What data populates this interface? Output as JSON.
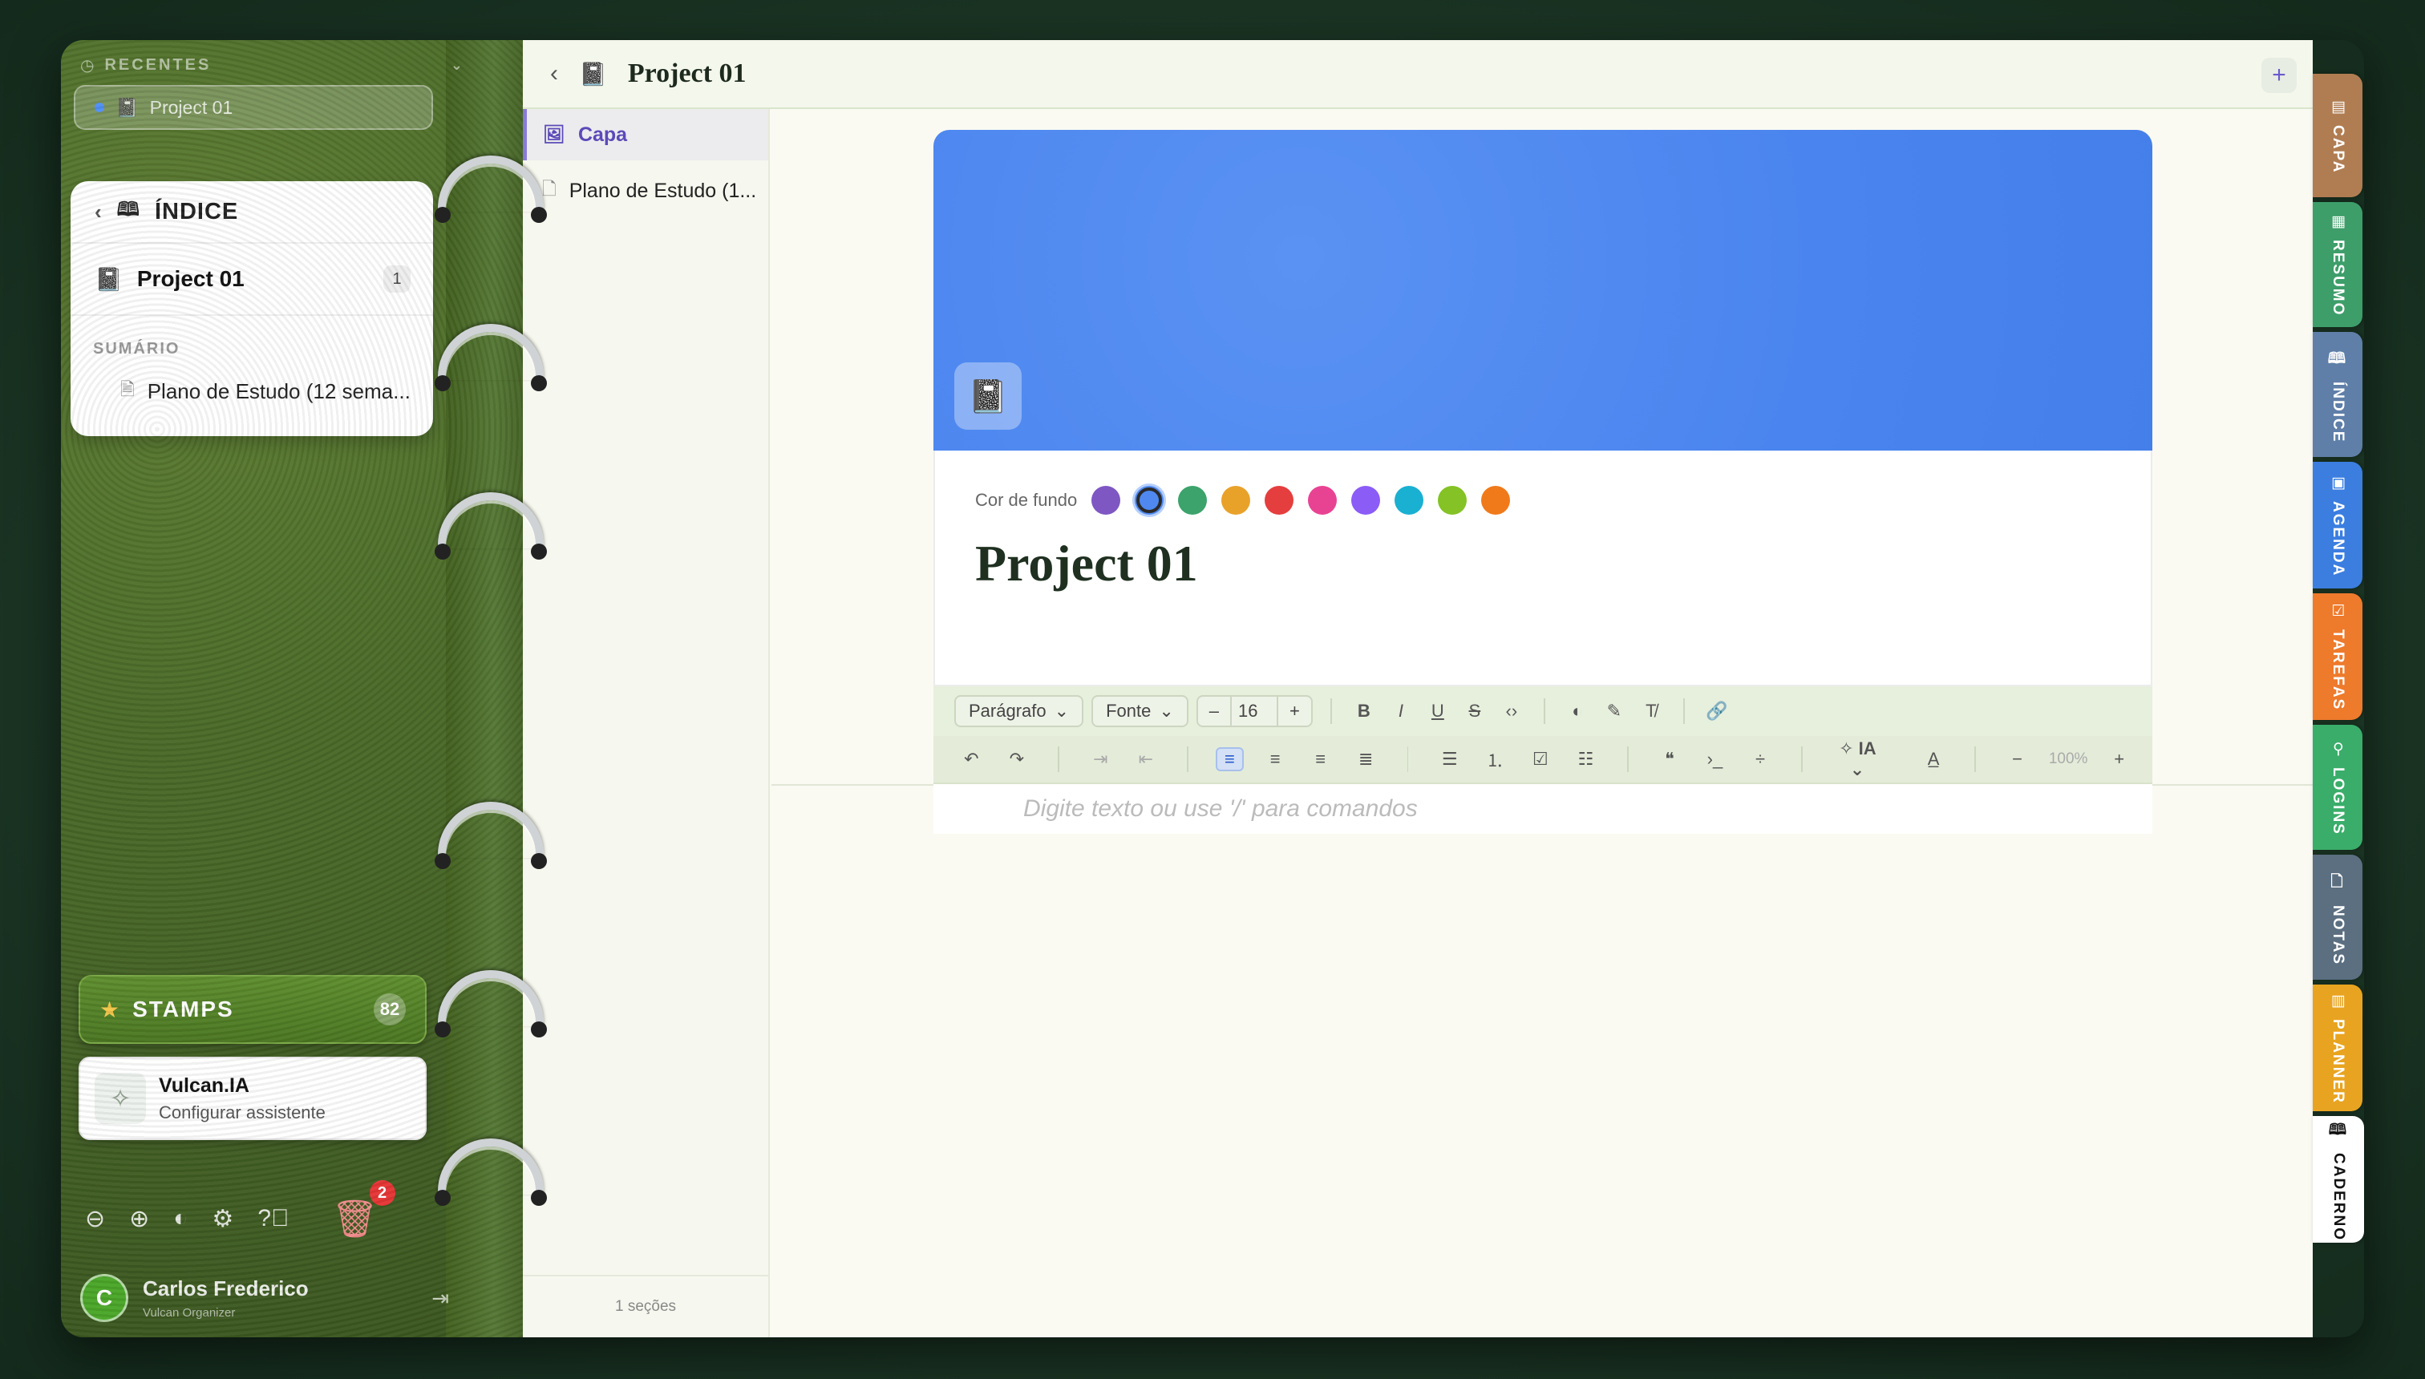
{
  "recentes": {
    "header": "RECENTES",
    "item": "Project 01"
  },
  "indice": {
    "title": "ÍNDICE",
    "project": "Project 01",
    "project_count": "1",
    "section_label": "SUMÁRIO",
    "items": [
      "Plano de Estudo (12 sema..."
    ]
  },
  "stamps": {
    "label": "STAMPS",
    "count": "82"
  },
  "assistant": {
    "name": "Vulcan.IA",
    "subtitle": "Configurar assistente"
  },
  "trash": {
    "count": "2"
  },
  "user": {
    "initial": "C",
    "name": "Carlos Frederico",
    "role": "Vulcan Organizer"
  },
  "topbar": {
    "title": "Project 01",
    "add": "+"
  },
  "sections": {
    "capa": "Capa",
    "items": [
      "Plano de Estudo (1..."
    ],
    "footer": "1 seções"
  },
  "cover": {
    "bg_label": "Cor de fundo",
    "title": "Project 01",
    "cover_color": "#4f89f0",
    "swatches": [
      "#7e57c2",
      "#4f89f0",
      "#3ba36b",
      "#e8a22a",
      "#e53e3e",
      "#e84393",
      "#8b5cf6",
      "#1ab0d1",
      "#84c225",
      "#f07a1a"
    ],
    "selected_swatch": 1
  },
  "toolbar": {
    "paragraph": "Parágrafo",
    "font": "Fonte",
    "size": "16",
    "minus": "–",
    "plus": "+",
    "ai": "IA",
    "zoom": "100%"
  },
  "editor": {
    "placeholder": "Digite texto ou use '/' para comandos"
  },
  "tabs": [
    {
      "label": "CAPA",
      "color": "#b07d52"
    },
    {
      "label": "RESUMO",
      "color": "#3d9e6a"
    },
    {
      "label": "ÍNDICE",
      "color": "#5f7fa8"
    },
    {
      "label": "AGENDA",
      "color": "#3b7ee0"
    },
    {
      "label": "TAREFAS",
      "color": "#ee7a2c"
    },
    {
      "label": "LOGINS",
      "color": "#3aad6a"
    },
    {
      "label": "NOTAS",
      "color": "#5b6f80"
    },
    {
      "label": "PLANNER",
      "color": "#e8a420"
    },
    {
      "label": "CADERNO",
      "color": "#ffffff"
    }
  ]
}
